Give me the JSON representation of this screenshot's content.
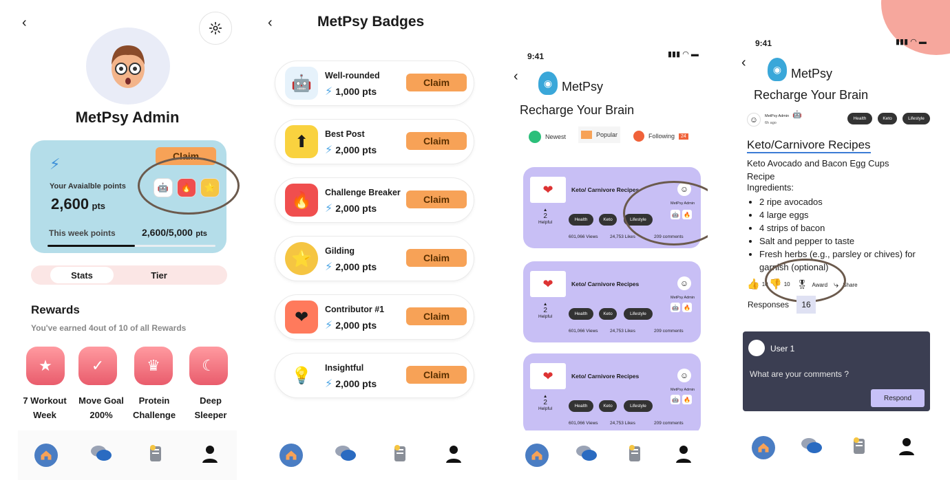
{
  "screen1": {
    "profile_name": "MetPsy Admin",
    "points_card": {
      "claim_label": "Claim",
      "available_label": "Your Avaialble points",
      "available_value": "2,600",
      "available_unit": "pts",
      "week_label": "This week points",
      "week_value": "2,600/5,000",
      "week_unit": "pts",
      "week_progress": 0.52
    },
    "toggle": {
      "stats": "Stats",
      "tier": "Tier"
    },
    "rewards": {
      "title": "Rewards",
      "subtitle": "You've earned 4out of 10 of all Rewards",
      "items": [
        {
          "line1": "7 Workout",
          "line2": "Week"
        },
        {
          "line1": "Move Goal",
          "line2": "200%"
        },
        {
          "line1": "Protein",
          "line2": "Challenge"
        },
        {
          "line1": "Deep",
          "line2": "Sleeper"
        }
      ]
    }
  },
  "screen2": {
    "title": "MetPsy Badges",
    "claim_label": "Claim",
    "badges": [
      {
        "name": "Well-rounded",
        "points": "1,000 pts"
      },
      {
        "name": "Best Post",
        "points": "2,000 pts"
      },
      {
        "name": "Challenge Breaker",
        "points": "2,000 pts"
      },
      {
        "name": "Gilding",
        "points": "2,000 pts"
      },
      {
        "name": "Contributor #1",
        "points": "2,000 pts"
      },
      {
        "name": "Insightful",
        "points": "2,000 pts"
      }
    ]
  },
  "screen3": {
    "time": "9:41",
    "brand": "MetPsy",
    "headline": "Recharge Your Brain",
    "filters": {
      "newest": "Newest",
      "popular": "Popular",
      "following": "Following",
      "following_count": "24"
    },
    "posts": [
      {
        "title": "Keto/ Carnivore Recipes",
        "helpful_count": "2",
        "helpful_label": "Helpful",
        "author": "MetPsy Admin",
        "tags": [
          "Health",
          "Keto",
          "Lifestyle"
        ],
        "views": "601,066 Views",
        "likes": "24,753 Likes",
        "comments": "209 comments"
      },
      {
        "title": "Keto/ Carnivore Recipes",
        "helpful_count": "2",
        "helpful_label": "Helpful",
        "author": "MetPsy Admin",
        "tags": [
          "Health",
          "Keto",
          "Lifestyle"
        ],
        "views": "601,066 Views",
        "likes": "24,753 Likes",
        "comments": "209 comments"
      },
      {
        "title": "Keto/ Carnivore Recipes",
        "helpful_count": "2",
        "helpful_label": "Helpful",
        "author": "MetPsy Admin",
        "tags": [
          "Health",
          "Keto",
          "Lifestyle"
        ],
        "views": "601,066 Views",
        "likes": "24,753 Likes",
        "comments": "209 comments"
      }
    ]
  },
  "screen4": {
    "time": "9:41",
    "brand": "MetPsy",
    "headline": "Recharge Your Brain",
    "author": "MetPsy Admin",
    "post_age": "6h ago",
    "tags": [
      "Health",
      "Keto",
      "Lifestyle"
    ],
    "post_title": "Keto/Carnivore Recipes",
    "recipe_title": "Keto Avocado and Bacon Egg Cups Recipe",
    "ingredients_label": "Ingredients:",
    "ingredients": [
      "2 ripe avocados",
      "4 large eggs",
      "4 strips of bacon",
      "Salt and pepper to taste",
      "Fresh herbs (e.g., parsley or chives) for garnish (optional)"
    ],
    "actions": {
      "likes": "10",
      "dislikes": "10",
      "award": "Award",
      "share": "Share"
    },
    "responses_label": "Responses",
    "responses_count": "16",
    "comment": {
      "user": "User 1",
      "placeholder": "What are your comments ?",
      "respond": "Respond"
    }
  },
  "colors": {
    "accent_orange": "#f7a257",
    "card_blue": "#b4dde9",
    "post_purple": "#c8bff5",
    "nav_blue": "#4a7dc3",
    "reward_pink": "#e95c6c"
  }
}
